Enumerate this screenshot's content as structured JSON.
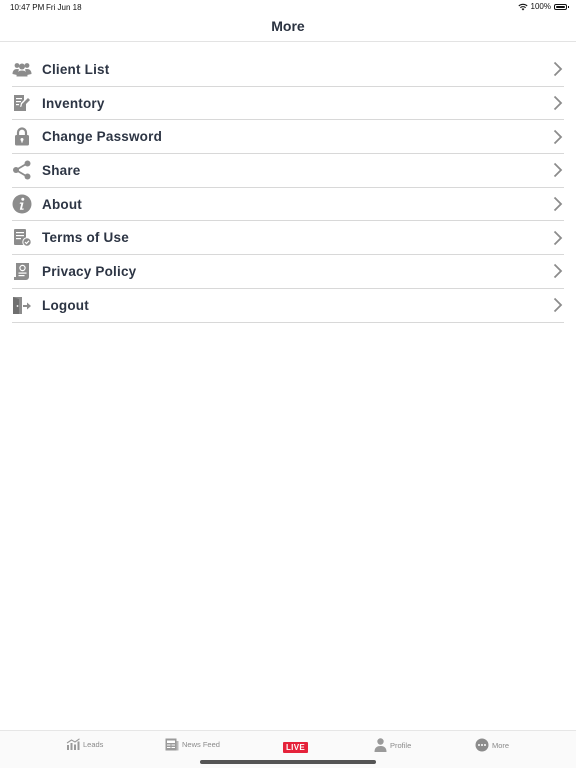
{
  "status_bar": {
    "time": "10:47 PM",
    "date": "Fri Jun 18",
    "battery": "100%",
    "battery_level": 1.0
  },
  "nav": {
    "title": "More"
  },
  "menu": {
    "items": [
      {
        "label": "Client List",
        "icon": "users-icon"
      },
      {
        "label": "Inventory",
        "icon": "inventory-icon"
      },
      {
        "label": "Change Password",
        "icon": "lock-icon"
      },
      {
        "label": "Share",
        "icon": "share-icon"
      },
      {
        "label": "About",
        "icon": "info-icon"
      },
      {
        "label": "Terms of Use",
        "icon": "terms-icon"
      },
      {
        "label": "Privacy Policy",
        "icon": "privacy-icon"
      },
      {
        "label": "Logout",
        "icon": "logout-icon"
      }
    ]
  },
  "tab_bar": {
    "tabs": [
      {
        "label": "Leads",
        "icon": "chart-icon"
      },
      {
        "label": "News Feed",
        "icon": "newspaper-icon"
      },
      {
        "label": "LIVE",
        "icon": "live-badge"
      },
      {
        "label": "Profile",
        "icon": "person-icon"
      },
      {
        "label": "More",
        "icon": "more-icon"
      }
    ]
  },
  "colors": {
    "icon_gray": "#8c8c8c",
    "text_dark": "#2d3544",
    "live_red": "#e5223a",
    "divider": "#d8d8d8"
  }
}
